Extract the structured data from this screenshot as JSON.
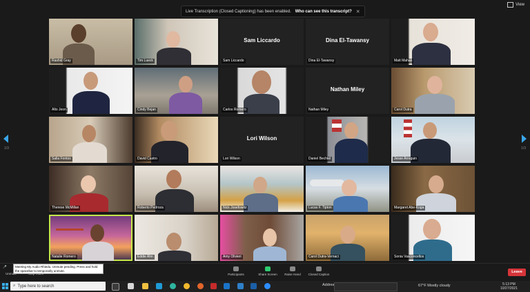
{
  "banner": {
    "message": "Live Transcription (Closed Captioning) has been enabled.",
    "question": "Who can see this transcript?",
    "close": "✕"
  },
  "view_label": "View",
  "pagination": {
    "left": "1/3",
    "right": "1/3"
  },
  "tiles": [
    {
      "name": "Rashid Gray",
      "label": ""
    },
    {
      "name": "Tim Lueck",
      "label": ""
    },
    {
      "name": "Sam Liccardo",
      "label": "Sam Liccardo"
    },
    {
      "name": "Dina El-Tawansy",
      "label": "Dina El-Tawansy"
    },
    {
      "name": "Matt Mahan",
      "label": ""
    },
    {
      "name": "Alto Jeon",
      "label": ""
    },
    {
      "name": "Cindy Bejan",
      "label": ""
    },
    {
      "name": "Carlos Romero",
      "label": ""
    },
    {
      "name": "Nathan Miley",
      "label": "Nathan Miley"
    },
    {
      "name": "Carol Dutra",
      "label": ""
    },
    {
      "name": "Salla Fontos",
      "label": ""
    },
    {
      "name": "David Castro",
      "label": ""
    },
    {
      "name": "Lori Wilson",
      "label": "Lori Wilson"
    },
    {
      "name": "Daniel Bechtel",
      "label": ""
    },
    {
      "name": "Jesse Arreguin",
      "label": ""
    },
    {
      "name": "Therese McMillan",
      "label": ""
    },
    {
      "name": "Roberto Pedroza",
      "label": ""
    },
    {
      "name": "Nick Josefowitz",
      "label": ""
    },
    {
      "name": "Lucas F. Tipton",
      "label": ""
    },
    {
      "name": "Margaret Abe-Koga",
      "label": ""
    },
    {
      "name": "Natalie Romero",
      "label": ""
    },
    {
      "name": "Eddie Ahn",
      "label": ""
    },
    {
      "name": "Amy Olivieri",
      "label": ""
    },
    {
      "name": "Carol Dutra-Vernaci",
      "label": ""
    },
    {
      "name": "Sonia Vasconcellos",
      "label": ""
    }
  ],
  "notice": "Meeting My Audio Rhiedu. Unmute pending. Press and hold the spacebar to temporarily unmute.",
  "toolbar": {
    "unmute": "Unmute",
    "stop_video": "Stop Video",
    "participants": "Participants",
    "share_screen": "Share Screen",
    "raise_hand": "Raise Hand",
    "closed_caption": "Closed Caption",
    "leave": "Leave"
  },
  "taskbar": {
    "search_placeholder": "Type here to search",
    "address_label": "Address",
    "weather": "67°F  Mostly cloudy",
    "time": "5:13 PM",
    "date": "10/27/2021"
  }
}
